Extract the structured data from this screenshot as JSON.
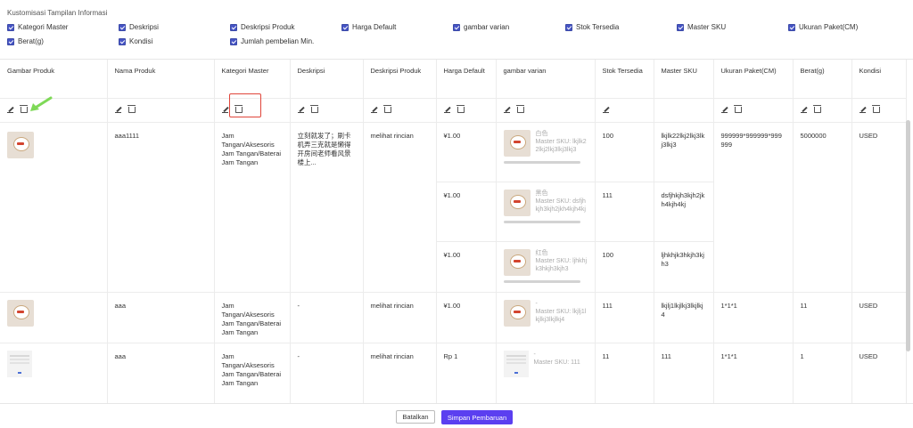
{
  "settings": {
    "title": "Kustomisasi Tampilan Informasi",
    "options": [
      {
        "label": "Kategori Master"
      },
      {
        "label": "Deskripsi"
      },
      {
        "label": "Deskripsi Produk"
      },
      {
        "label": "Harga Default"
      },
      {
        "label": "gambar varian"
      },
      {
        "label": "Stok Tersedia"
      },
      {
        "label": "Master SKU"
      },
      {
        "label": "Ukuran Paket(CM)"
      },
      {
        "label": "Berat(g)"
      },
      {
        "label": "Kondisi"
      },
      {
        "label": "Jumlah pembelian Min."
      }
    ]
  },
  "table": {
    "headers": [
      "Gambar Produk",
      "Nama Produk",
      "Kategori Master",
      "Deskripsi",
      "Deskripsi Produk",
      "Harga Default",
      "gambar varian",
      "Stok Tersedia",
      "Master SKU",
      "Ukuran Paket(CM)",
      "Berat(g)",
      "Kondisi"
    ],
    "rows": [
      {
        "name": "aaa1111",
        "category": "Jam Tangan/Aksesoris Jam Tangan/Baterai Jam Tangan",
        "description": "立刻就发了；刷卡机弄三克就是懒得开房间老师看风景楼上...",
        "product_desc": "melihat rincian",
        "size": "999999*999999*999999",
        "weight": "5000000",
        "condition": "USED",
        "variants": [
          {
            "price": "¥1.00",
            "name": "白色",
            "sku_label": "Master SKU: lkjlk22lkj2lkj3lkj3lkj3",
            "stock": "100",
            "sku": "lkjlk22lkj2lkj3lkj3lkj3"
          },
          {
            "price": "¥1.00",
            "name": "黑色",
            "sku_label": "Master SKU: dsfjhkjh3kjh2jkh4kjh4kj",
            "stock": "111",
            "sku": "dsfjhkjh3kjh2jkh4kjh4kj"
          },
          {
            "price": "¥1.00",
            "name": "红色",
            "sku_label": "Master SKU: ljhkhjk3hkjh3kjh3",
            "stock": "100",
            "sku": "ljhkhjk3hkjh3kjh3"
          }
        ]
      },
      {
        "name": "aaa",
        "category": "Jam Tangan/Aksesoris Jam Tangan/Baterai Jam Tangan",
        "description": "-",
        "product_desc": "melihat rincian",
        "price": "¥1.00",
        "variant_name": "-",
        "variant_sku": "Master SKU: lkjlj1lkjlkj3lkjlkj4",
        "stock": "111",
        "sku": "lkjlj1lkjlkj3lkjlkj4",
        "size": "1*1*1",
        "weight": "11",
        "condition": "USED"
      },
      {
        "name": "aaa",
        "category": "Jam Tangan/Aksesoris Jam Tangan/Baterai Jam Tangan",
        "description": "-",
        "product_desc": "melihat rincian",
        "price": "Rp 1",
        "variant_name": "-",
        "variant_sku": "Master SKU: 111",
        "stock": "11",
        "sku": "111",
        "size": "1*1*1",
        "weight": "1",
        "condition": "USED"
      }
    ]
  },
  "footer": {
    "cancel": "Batalkan",
    "save": "Simpan Pembaruan"
  },
  "colors": {
    "accent": "#5b3ff0",
    "highlight": "#e0453a",
    "arrow": "#7ed957"
  }
}
